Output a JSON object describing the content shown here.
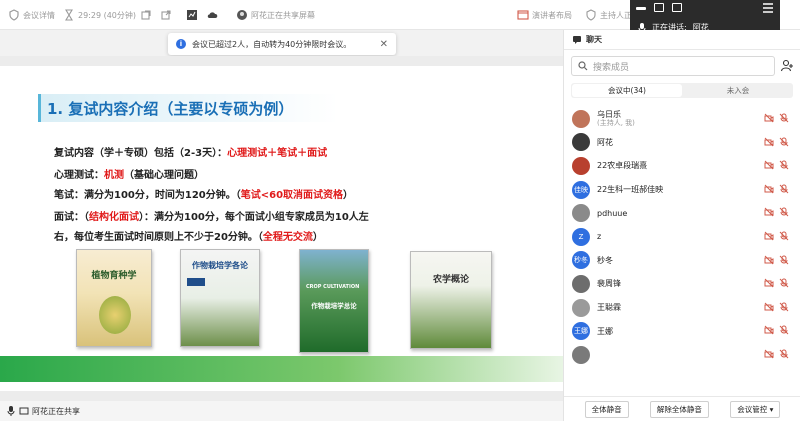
{
  "toolbar": {
    "meeting_details": "会议详情",
    "duration": "29:29 (40分钟)",
    "sharing_screen": "阿花正在共享屏幕",
    "speaker_layout": "演讲者布局",
    "host_audio": "主持人正"
  },
  "speaking": {
    "label": "正在讲话:",
    "name": "阿花"
  },
  "notice": {
    "text": "会议已超过2人，自动转为40分钟限时会议。"
  },
  "slide": {
    "title": "1. 复试内容介绍（主要以专硕为例）",
    "line1_a": "复试内容（学＋专硕）包括（2-3天）：",
    "line1_b": "心理测试＋笔试＋面试",
    "line2_a": "心理测试：",
    "line2_b": "机测",
    "line2_c": "（基础心理问题）",
    "line3_a": "笔试：满分为100分，时间为120分钟。（",
    "line3_b": "笔试<60取消面试资格",
    "line3_c": "）",
    "line4_a": "面试：（",
    "line4_b": "结构化面试",
    "line4_c": "）：满分为100分，每个面试小组专家成员为10人左",
    "line5_a": "右，每位考生面试时间原则上不少于20分钟。（",
    "line5_b": "全程无交流",
    "line5_c": "）",
    "books": [
      {
        "title": "植物育种学"
      },
      {
        "title": "作物栽培学各论"
      },
      {
        "title": "作物栽培学总论"
      },
      {
        "title": "农学概论"
      }
    ]
  },
  "sharing_status": "阿花正在共享",
  "panel": {
    "tab": "聊天",
    "search_placeholder": "搜索成员",
    "seg_in": "会议中(34)",
    "seg_out": "未入会",
    "members": [
      {
        "name": "乌日乐",
        "sub": "(主持人, 我)",
        "color": "#c0745a",
        "initial": ""
      },
      {
        "name": "阿花",
        "sub": "",
        "color": "#3a3a3a",
        "initial": ""
      },
      {
        "name": "22农卓段瑞熹",
        "sub": "",
        "color": "#b8402e",
        "initial": ""
      },
      {
        "name": "22生科一班郝佳映",
        "sub": "",
        "color": "#2f6fe0",
        "initial": "佳映"
      },
      {
        "name": "pdhuue",
        "sub": "",
        "color": "#8a8a8a",
        "initial": ""
      },
      {
        "name": "z",
        "sub": "",
        "color": "#2f6fe0",
        "initial": "Z"
      },
      {
        "name": "秒冬",
        "sub": "",
        "color": "#2f6fe0",
        "initial": "秒冬"
      },
      {
        "name": "裴周锋",
        "sub": "",
        "color": "#6d6d6d",
        "initial": ""
      },
      {
        "name": "王聪霖",
        "sub": "",
        "color": "#9a9a9a",
        "initial": ""
      },
      {
        "name": "王娜",
        "sub": "",
        "color": "#2f6fe0",
        "initial": "王娜"
      },
      {
        "name": "",
        "sub": "",
        "color": "#7a7a7a",
        "initial": ""
      }
    ],
    "mute_all": "全体静音",
    "unmute_all": "解除全体静音",
    "controls": "会议管控"
  }
}
